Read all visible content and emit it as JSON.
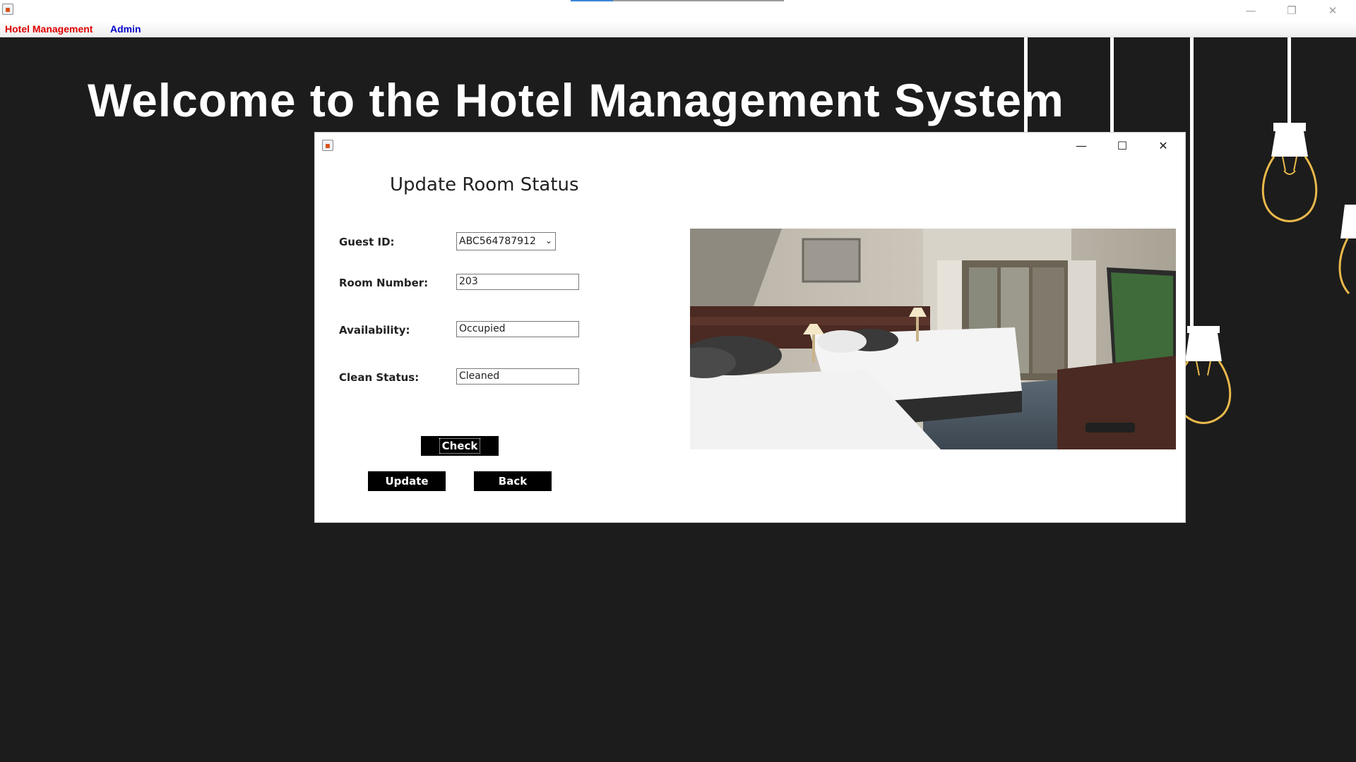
{
  "main_window": {
    "menu": {
      "hotel_management": "Hotel Management",
      "admin": "Admin"
    },
    "controls": {
      "minimize": "—",
      "restore": "❐",
      "close": "✕"
    },
    "progress_fraction": 0.2
  },
  "desktop": {
    "welcome_text": "Welcome to the Hotel Management System"
  },
  "dialog": {
    "heading": "Update Room Status",
    "controls": {
      "minimize": "—",
      "maximize": "☐",
      "close": "✕"
    },
    "fields": {
      "guest_id": {
        "label": "Guest ID:",
        "value": "ABC564787912"
      },
      "room_number": {
        "label": "Room Number:",
        "value": "203"
      },
      "availability": {
        "label": "Availability:",
        "value": "Occupied"
      },
      "clean_status": {
        "label": "Clean Status:",
        "value": "Cleaned"
      }
    },
    "buttons": {
      "check": "Check",
      "update": "Update",
      "back": "Back"
    },
    "icons": {
      "window": "java-app-icon",
      "dropdown": "chevron-down-icon"
    }
  },
  "colors": {
    "menu_hotel": "#e00000",
    "menu_admin": "#0000cc",
    "desktop_background": "#1c1c1c",
    "bulb_glow": "#e8b84a"
  }
}
